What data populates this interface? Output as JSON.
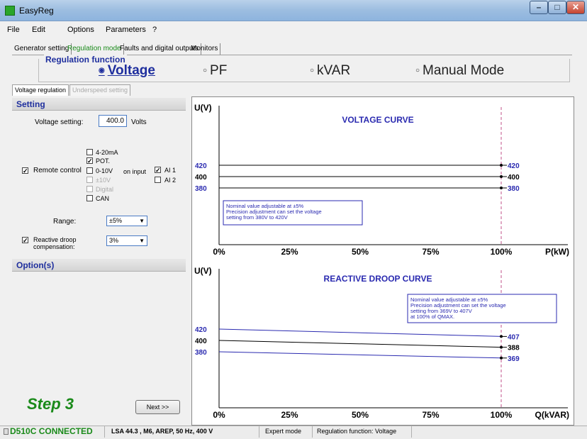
{
  "window": {
    "title": "EasyReg"
  },
  "menu": [
    "File",
    "Edit",
    "Options",
    "Parameters",
    "?"
  ],
  "main_tabs": [
    "Generator setting",
    "Regulation mode",
    "Faults and digital outputs",
    "Monitors"
  ],
  "regulation_function": {
    "title": "Regulation function",
    "options": [
      "Voltage",
      "PF",
      "kVAR",
      "Manual Mode"
    ],
    "selected": "Voltage"
  },
  "sub_tabs": [
    "Voltage regulation",
    "Underspeed setting"
  ],
  "setting": {
    "header": "Setting",
    "voltage_label": "Voltage setting:",
    "voltage_value": "400.0",
    "voltage_unit": "Volts",
    "remote_control_label": "Remote control",
    "remote_control_checked": true,
    "remote_types": [
      {
        "label": "4-20mA",
        "checked": false,
        "enabled": true
      },
      {
        "label": "POT.",
        "checked": true,
        "enabled": true
      },
      {
        "label": "0-10V",
        "checked": false,
        "enabled": true
      },
      {
        "label": "±10V",
        "checked": false,
        "enabled": false
      },
      {
        "label": "Digital",
        "checked": false,
        "enabled": false
      },
      {
        "label": "CAN",
        "checked": false,
        "enabled": true
      }
    ],
    "on_input_label": "on input",
    "inputs": [
      {
        "label": "AI 1",
        "checked": true
      },
      {
        "label": "AI 2",
        "checked": false
      }
    ],
    "range_label": "Range:",
    "range_value": "±5%",
    "droop_label_1": "Reactive droop",
    "droop_label_2": "compensation:",
    "droop_checked": true,
    "droop_value": "3%"
  },
  "options": {
    "header": "Option(s)"
  },
  "step_label": "Step 3",
  "next_button": "Next >>",
  "chart_data": [
    {
      "type": "line",
      "title": "VOLTAGE CURVE",
      "ylabel": "U(V)",
      "xlabel": "P(kW)",
      "x_ticks": [
        "0%",
        "25%",
        "50%",
        "75%",
        "100%"
      ],
      "series": [
        {
          "x": [
            0,
            100
          ],
          "values": [
            420,
            420
          ],
          "end_label": "420"
        },
        {
          "x": [
            0,
            100
          ],
          "values": [
            400,
            400
          ],
          "end_label": "400"
        },
        {
          "x": [
            0,
            100
          ],
          "values": [
            380,
            380
          ],
          "end_label": "380"
        }
      ],
      "y_labels": [
        "420",
        "400",
        "380"
      ],
      "annotation": [
        "Nominal value adjustable at ±5%",
        "Precision adjustment can set the voltage",
        "setting from 380V to 420V"
      ]
    },
    {
      "type": "line",
      "title": "REACTIVE DROOP CURVE",
      "ylabel": "U(V)",
      "xlabel": "Q(kVAR)",
      "x_ticks": [
        "0%",
        "25%",
        "50%",
        "75%",
        "100%"
      ],
      "series": [
        {
          "x": [
            0,
            100
          ],
          "values": [
            420,
            407
          ],
          "end_label": "407"
        },
        {
          "x": [
            0,
            100
          ],
          "values": [
            400,
            388
          ],
          "end_label": "388"
        },
        {
          "x": [
            0,
            100
          ],
          "values": [
            380,
            369
          ],
          "end_label": "369"
        }
      ],
      "y_labels": [
        "420",
        "400",
        "380"
      ],
      "annotation": [
        "Nominal value adjustable at ±5%",
        "Precision adjustment can set the voltage",
        "setting from 369V to 407V",
        "at 100% of QMAX."
      ]
    }
  ],
  "status": {
    "connection": "D510C CONNECTED",
    "machine": "LSA 44.3 , M6, AREP, 50 Hz, 400 V",
    "mode": "Expert mode",
    "function": "Regulation function: Voltage"
  },
  "colors": {
    "accent": "#1f2f9e",
    "green": "#1a8a1a",
    "line_dark": "#000000",
    "line_blue": "#2a2ab0",
    "marker_line": "#c0508a"
  }
}
